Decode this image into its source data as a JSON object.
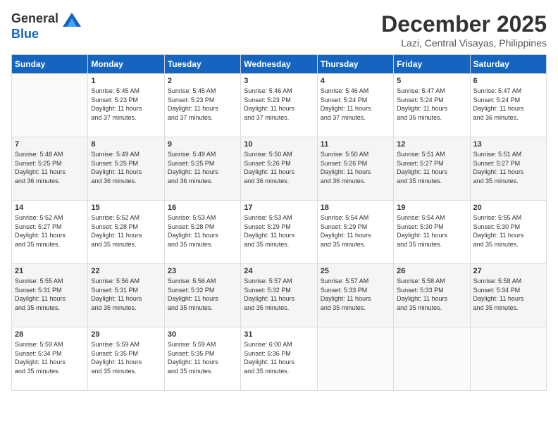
{
  "header": {
    "logo_general": "General",
    "logo_blue": "Blue",
    "month": "December 2025",
    "location": "Lazi, Central Visayas, Philippines"
  },
  "days_of_week": [
    "Sunday",
    "Monday",
    "Tuesday",
    "Wednesday",
    "Thursday",
    "Friday",
    "Saturday"
  ],
  "weeks": [
    [
      {
        "day": "",
        "info": ""
      },
      {
        "day": "1",
        "info": "Sunrise: 5:45 AM\nSunset: 5:23 PM\nDaylight: 11 hours\nand 37 minutes."
      },
      {
        "day": "2",
        "info": "Sunrise: 5:45 AM\nSunset: 5:23 PM\nDaylight: 11 hours\nand 37 minutes."
      },
      {
        "day": "3",
        "info": "Sunrise: 5:46 AM\nSunset: 5:23 PM\nDaylight: 11 hours\nand 37 minutes."
      },
      {
        "day": "4",
        "info": "Sunrise: 5:46 AM\nSunset: 5:24 PM\nDaylight: 11 hours\nand 37 minutes."
      },
      {
        "day": "5",
        "info": "Sunrise: 5:47 AM\nSunset: 5:24 PM\nDaylight: 11 hours\nand 36 minutes."
      },
      {
        "day": "6",
        "info": "Sunrise: 5:47 AM\nSunset: 5:24 PM\nDaylight: 11 hours\nand 36 minutes."
      }
    ],
    [
      {
        "day": "7",
        "info": "Sunrise: 5:48 AM\nSunset: 5:25 PM\nDaylight: 11 hours\nand 36 minutes."
      },
      {
        "day": "8",
        "info": "Sunrise: 5:49 AM\nSunset: 5:25 PM\nDaylight: 11 hours\nand 36 minutes."
      },
      {
        "day": "9",
        "info": "Sunrise: 5:49 AM\nSunset: 5:25 PM\nDaylight: 11 hours\nand 36 minutes."
      },
      {
        "day": "10",
        "info": "Sunrise: 5:50 AM\nSunset: 5:26 PM\nDaylight: 11 hours\nand 36 minutes."
      },
      {
        "day": "11",
        "info": "Sunrise: 5:50 AM\nSunset: 5:26 PM\nDaylight: 11 hours\nand 36 minutes."
      },
      {
        "day": "12",
        "info": "Sunrise: 5:51 AM\nSunset: 5:27 PM\nDaylight: 11 hours\nand 35 minutes."
      },
      {
        "day": "13",
        "info": "Sunrise: 5:51 AM\nSunset: 5:27 PM\nDaylight: 11 hours\nand 35 minutes."
      }
    ],
    [
      {
        "day": "14",
        "info": "Sunrise: 5:52 AM\nSunset: 5:27 PM\nDaylight: 11 hours\nand 35 minutes."
      },
      {
        "day": "15",
        "info": "Sunrise: 5:52 AM\nSunset: 5:28 PM\nDaylight: 11 hours\nand 35 minutes."
      },
      {
        "day": "16",
        "info": "Sunrise: 5:53 AM\nSunset: 5:28 PM\nDaylight: 11 hours\nand 35 minutes."
      },
      {
        "day": "17",
        "info": "Sunrise: 5:53 AM\nSunset: 5:29 PM\nDaylight: 11 hours\nand 35 minutes."
      },
      {
        "day": "18",
        "info": "Sunrise: 5:54 AM\nSunset: 5:29 PM\nDaylight: 11 hours\nand 35 minutes."
      },
      {
        "day": "19",
        "info": "Sunrise: 5:54 AM\nSunset: 5:30 PM\nDaylight: 11 hours\nand 35 minutes."
      },
      {
        "day": "20",
        "info": "Sunrise: 5:55 AM\nSunset: 5:30 PM\nDaylight: 11 hours\nand 35 minutes."
      }
    ],
    [
      {
        "day": "21",
        "info": "Sunrise: 5:55 AM\nSunset: 5:31 PM\nDaylight: 11 hours\nand 35 minutes."
      },
      {
        "day": "22",
        "info": "Sunrise: 5:56 AM\nSunset: 5:31 PM\nDaylight: 11 hours\nand 35 minutes."
      },
      {
        "day": "23",
        "info": "Sunrise: 5:56 AM\nSunset: 5:32 PM\nDaylight: 11 hours\nand 35 minutes."
      },
      {
        "day": "24",
        "info": "Sunrise: 5:57 AM\nSunset: 5:32 PM\nDaylight: 11 hours\nand 35 minutes."
      },
      {
        "day": "25",
        "info": "Sunrise: 5:57 AM\nSunset: 5:33 PM\nDaylight: 11 hours\nand 35 minutes."
      },
      {
        "day": "26",
        "info": "Sunrise: 5:58 AM\nSunset: 5:33 PM\nDaylight: 11 hours\nand 35 minutes."
      },
      {
        "day": "27",
        "info": "Sunrise: 5:58 AM\nSunset: 5:34 PM\nDaylight: 11 hours\nand 35 minutes."
      }
    ],
    [
      {
        "day": "28",
        "info": "Sunrise: 5:59 AM\nSunset: 5:34 PM\nDaylight: 11 hours\nand 35 minutes."
      },
      {
        "day": "29",
        "info": "Sunrise: 5:59 AM\nSunset: 5:35 PM\nDaylight: 11 hours\nand 35 minutes."
      },
      {
        "day": "30",
        "info": "Sunrise: 5:59 AM\nSunset: 5:35 PM\nDaylight: 11 hours\nand 35 minutes."
      },
      {
        "day": "31",
        "info": "Sunrise: 6:00 AM\nSunset: 5:36 PM\nDaylight: 11 hours\nand 35 minutes."
      },
      {
        "day": "",
        "info": ""
      },
      {
        "day": "",
        "info": ""
      },
      {
        "day": "",
        "info": ""
      }
    ]
  ]
}
